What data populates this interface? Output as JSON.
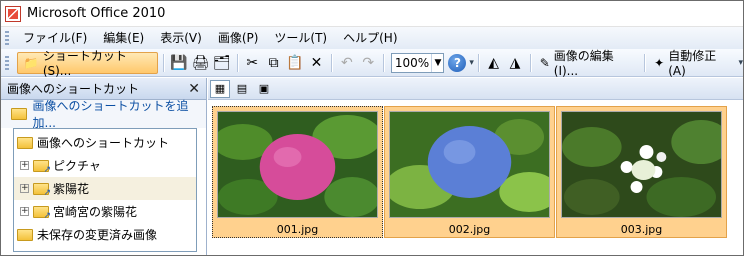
{
  "window": {
    "title": "Microsoft Office 2010"
  },
  "menu": [
    "ファイル(F)",
    "編集(E)",
    "表示(V)",
    "画像(P)",
    "ツール(T)",
    "ヘルプ(H)"
  ],
  "toolbar": {
    "shortcut_label": "ショートカット(S)...",
    "zoom_value": "100%",
    "edit_image_label": "画像の編集(I)...",
    "auto_fix_label": "自動修正(A)"
  },
  "pane": {
    "title": "画像へのショートカット",
    "add_link": "画像へのショートカットを追加...",
    "tree": [
      {
        "label": "画像へのショートカット"
      },
      {
        "label": "ピクチャ"
      },
      {
        "label": "紫陽花"
      },
      {
        "label": "宮崎宮の紫陽花"
      },
      {
        "label": "未保存の変更済み画像"
      }
    ]
  },
  "thumbnails": [
    {
      "filename": "001.jpg",
      "flower_color": "#d64c9a"
    },
    {
      "filename": "002.jpg",
      "flower_color": "#5b7fd6"
    },
    {
      "filename": "003.jpg",
      "flower_color": "#ffffff"
    }
  ]
}
